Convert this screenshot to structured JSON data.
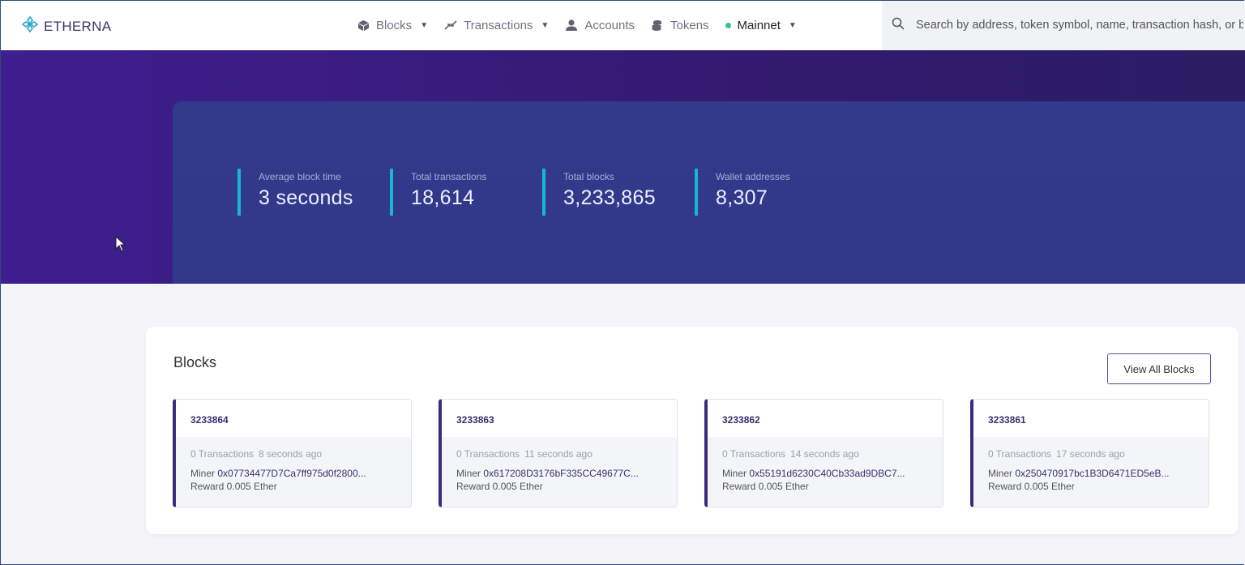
{
  "brand": {
    "name": "ETHERNA"
  },
  "nav": {
    "blocks": "Blocks",
    "transactions": "Transactions",
    "accounts": "Accounts",
    "tokens": "Tokens",
    "network": "Mainnet"
  },
  "search": {
    "placeholder": "Search by address, token symbol, name, transaction hash, or block number"
  },
  "stats": [
    {
      "label": "Average block time",
      "value": "3 seconds"
    },
    {
      "label": "Total transactions",
      "value": "18,614"
    },
    {
      "label": "Total blocks",
      "value": "3,233,865"
    },
    {
      "label": "Wallet addresses",
      "value": "8,307"
    }
  ],
  "blocks": {
    "title": "Blocks",
    "view_all": "View All Blocks",
    "miner_label": "Miner",
    "items": [
      {
        "number": "3233864",
        "transactions": "0 Transactions",
        "ago": "8 seconds ago",
        "miner": "0x07734477D7Ca7ff975d0f2800...",
        "reward": "Reward 0.005 Ether"
      },
      {
        "number": "3233863",
        "transactions": "0 Transactions",
        "ago": "11 seconds ago",
        "miner": "0x617208D3176bF335CC49677C...",
        "reward": "Reward 0.005 Ether"
      },
      {
        "number": "3233862",
        "transactions": "0 Transactions",
        "ago": "14 seconds ago",
        "miner": "0x55191d6230C40Cb33ad9DBC7...",
        "reward": "Reward 0.005 Ether"
      },
      {
        "number": "3233861",
        "transactions": "0 Transactions",
        "ago": "17 seconds ago",
        "miner": "0x250470917bc1B3D6471ED5eB...",
        "reward": "Reward 0.005 Ether"
      }
    ]
  },
  "colors": {
    "accent": "#15b6d6",
    "brand": "#3c2a7d",
    "hero": "#3f1e8f",
    "stats_panel": "#323a8c",
    "online": "#33c48b"
  }
}
